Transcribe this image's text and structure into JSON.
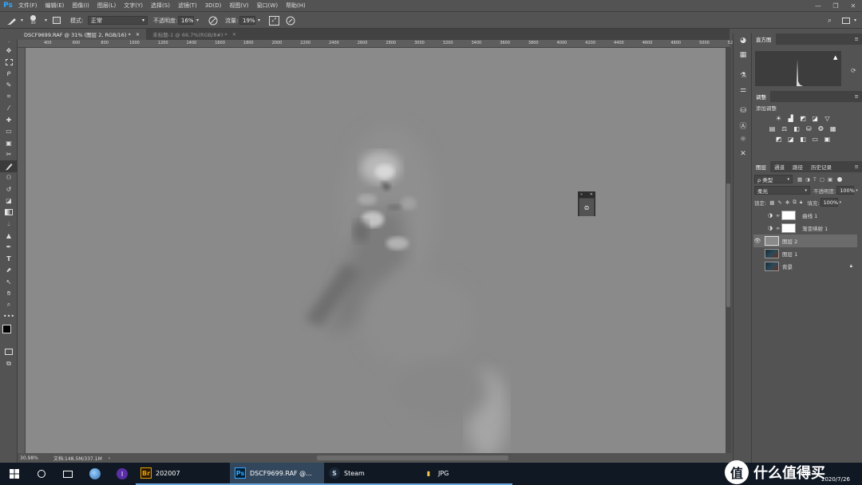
{
  "app": {
    "logo": "Ps"
  },
  "menu": [
    "文件(F)",
    "编辑(E)",
    "图像(I)",
    "图层(L)",
    "文字(Y)",
    "选择(S)",
    "滤镜(T)",
    "3D(D)",
    "视图(V)",
    "窗口(W)",
    "帮助(H)"
  ],
  "options": {
    "brush_size": "30",
    "mode_label": "模式:",
    "mode_value": "正常",
    "opacity_label": "不透明度:",
    "opacity_value": "16%",
    "flow_label": "流量:",
    "flow_value": "19%"
  },
  "tabs": [
    {
      "label": "DSCF9699.RAF @ 31% (图层 2, RGB/16) *",
      "close": "×"
    },
    {
      "label": "未标题-1 @ 66.7%(RGB/8#) *",
      "close": "×"
    }
  ],
  "ruler_labels": [
    "400",
    "600",
    "800",
    "1000",
    "1200",
    "1400",
    "1600",
    "1800",
    "2000",
    "2200",
    "2400",
    "2600",
    "2800",
    "3000",
    "3200",
    "3400",
    "3600",
    "3800",
    "4000",
    "4200",
    "4400",
    "4600",
    "4800",
    "5000",
    "5200"
  ],
  "status": {
    "zoom": "30.98%",
    "doc": "文档:148.5M/337.1M",
    "arrow": "›"
  },
  "histogram": {
    "tab": "直方图",
    "warning": "▲"
  },
  "adjustments": {
    "tab": "调整",
    "add_label": "添加调整"
  },
  "layers_panel": {
    "tabs": [
      "图层",
      "通道",
      "路径",
      "历史记录"
    ],
    "filter_label": "ρ 类型",
    "blend_mode": "柔光",
    "opacity_label": "不透明度:",
    "opacity_value": "100%",
    "lock_label": "锁定:",
    "fill_label": "填充:",
    "fill_value": "100%",
    "layers": [
      {
        "name": "曲线 1",
        "visible": false,
        "type": "adjustment"
      },
      {
        "name": "渐变映射 1",
        "visible": false,
        "type": "adjustment"
      },
      {
        "name": "图层 2",
        "visible": true,
        "type": "pixel",
        "selected": true
      },
      {
        "name": "图层 1",
        "visible": false,
        "type": "pixel"
      },
      {
        "name": "背景",
        "visible": false,
        "type": "background",
        "locked": true
      }
    ]
  },
  "taskbar": {
    "apps": [
      {
        "label": "202007",
        "icon": "Br"
      },
      {
        "label": "DSCF9699.RAF @...",
        "icon": "Ps"
      },
      {
        "label": "Steam",
        "icon": "S"
      },
      {
        "label": "JPG",
        "icon": "▮"
      }
    ],
    "lang": "ENG",
    "date": "2020/7/26"
  },
  "watermark": "值 什么值得买"
}
